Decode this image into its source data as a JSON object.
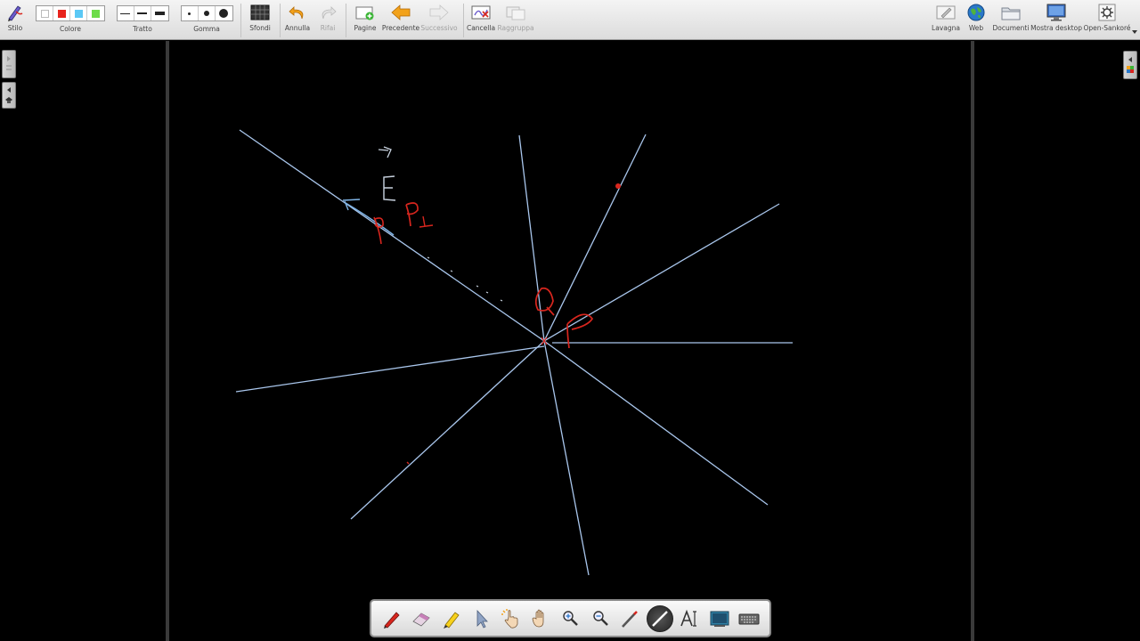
{
  "toolbar": {
    "stylus": "Stilo",
    "color": "Colore",
    "stroke": "Tratto",
    "eraser": "Gomma",
    "backgrounds": "Sfondi",
    "undo": "Annulla",
    "redo": "Rifai",
    "pages": "Pagine",
    "previous": "Precedente",
    "next": "Successivo",
    "clear": "Cancella",
    "group": "Raggruppa",
    "board": "Lavagna",
    "web": "Web",
    "documents": "Documenti",
    "show_desktop": "Mostra desktop",
    "open_sankore": "Open-Sankoré"
  },
  "palette": {
    "colors": [
      "#ffffff",
      "#e8231c",
      "#5bc8f5",
      "#6ddc4a"
    ]
  },
  "drawing": {
    "line_color": "#a9c6ec",
    "ink_red": "#d8261e",
    "ink_blue": "#7fb4e6",
    "ink_white": "#c9d3e0",
    "annotations": [
      "E",
      "P",
      "1",
      "Q"
    ]
  },
  "dock": {
    "tools": [
      "pen-icon",
      "eraser-icon",
      "highlighter-icon",
      "selector-icon",
      "interactor-icon",
      "hand-icon",
      "zoom-in-icon",
      "zoom-out-icon",
      "pointer-icon",
      "line-icon",
      "text-icon",
      "capture-icon",
      "keyboard-icon"
    ],
    "active": "line-icon"
  }
}
